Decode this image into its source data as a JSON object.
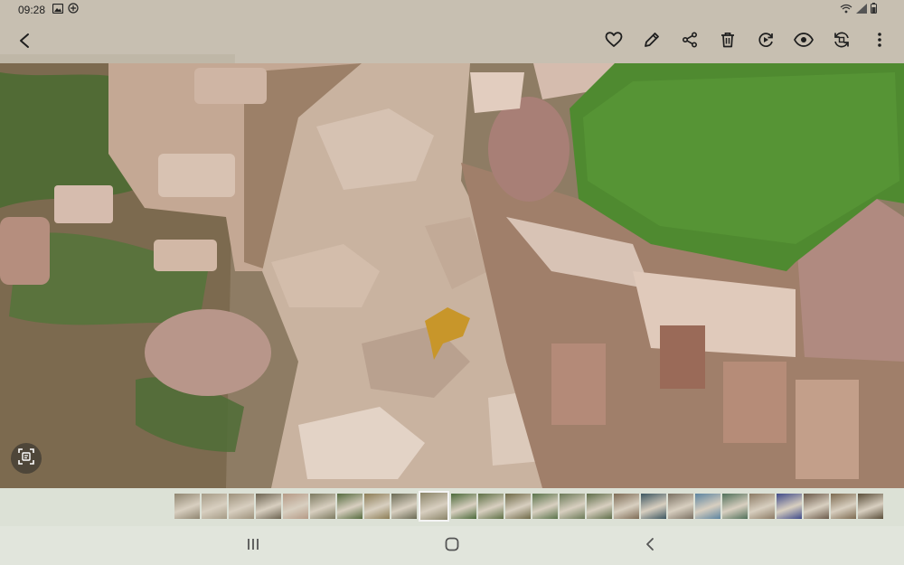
{
  "status_bar": {
    "time": "09:28",
    "left_icons": [
      "image-icon",
      "sync-plus-icon"
    ],
    "right_icons": [
      "wifi-icon",
      "signal-icon",
      "battery-icon"
    ]
  },
  "app_bar": {
    "back_icon": "back-arrow-icon",
    "actions": [
      {
        "name": "favorite",
        "icon": "heart-icon"
      },
      {
        "name": "edit",
        "icon": "pencil-icon"
      },
      {
        "name": "share",
        "icon": "share-icon"
      },
      {
        "name": "delete",
        "icon": "trash-icon"
      },
      {
        "name": "remaster",
        "icon": "remaster-icon"
      },
      {
        "name": "bixby-vision",
        "icon": "eye-icon"
      },
      {
        "name": "rotate",
        "icon": "rotate-icon"
      },
      {
        "name": "more-options",
        "icon": "more-vertical-icon"
      }
    ]
  },
  "photo": {
    "subject": "stone-path-with-stone-walls-and-lawn"
  },
  "overlay": {
    "scan_button_icon": "scan-text-icon"
  },
  "filmstrip": {
    "current_index": 9,
    "thumbnails": [
      "#8f8570",
      "#a59b86",
      "#9d917b",
      "#6d6452",
      "#b59a86",
      "#7c7a60",
      "#556b3e",
      "#8c7d56",
      "#6a6a54",
      "#8a8468",
      "#4b6a3a",
      "#5e7045",
      "#6f6a48",
      "#59734a",
      "#6b7a58",
      "#5f6e4a",
      "#7d6b55",
      "#3c5660",
      "#7a7062",
      "#5c84a0",
      "#50705a",
      "#8b7a64",
      "#3f4a8a",
      "#6b5a4a",
      "#7c6a50",
      "#5a4e3a"
    ]
  },
  "nav_bar": {
    "recents_icon": "recents-icon",
    "home_icon": "home-icon",
    "back_icon": "nav-back-icon"
  },
  "colors": {
    "grass": "#4a8a2e",
    "stone": "#c9ad9c",
    "dirt": "#7a6850",
    "bar_tint": "#f2f2ee"
  }
}
